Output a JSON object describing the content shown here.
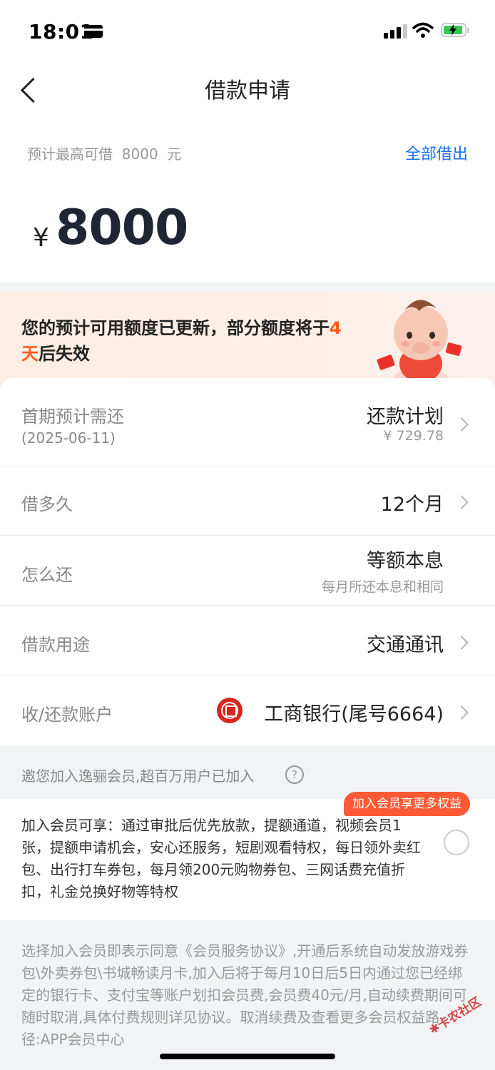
{
  "status_bar": {
    "time": "18:01"
  },
  "nav": {
    "title": "借款申请"
  },
  "amount": {
    "max_text": "预计最高可借  8000  元",
    "borrow_all": "全部借出",
    "currency": "¥",
    "value": "8000"
  },
  "banner": {
    "text_before": "您的预计可用额度已更新，部分额度将于",
    "highlight": "4天",
    "text_after": "后失效"
  },
  "rows": {
    "first_payment": {
      "label": "首期预计需还",
      "date": "(2025-06-11)",
      "value": "还款计划",
      "sub": "¥ 729.78"
    },
    "duration": {
      "label": "借多久",
      "value": "12个月"
    },
    "repay_method": {
      "label": "怎么还",
      "value": "等额本息",
      "sub": "每月所还本息和相同"
    },
    "purpose": {
      "label": "借款用途",
      "value": "交通通讯"
    },
    "account": {
      "label": "收/还款账户",
      "value": "工商银行(尾号6664)"
    }
  },
  "member": {
    "title": "邀您加入逸骊会员,超百万用户已加入",
    "badge": "加入会员享更多权益",
    "benefits": "加入会员可享：通过审批后优先放款，提额通道，视频会员1张，提额申请机会，安心还服务，短剧观看特权，每日领外卖红包、出行打车券包，每月领200元购物券包、三网话费充值折扣，礼金兑换好物等特权",
    "agreement": "选择加入会员即表示同意《会员服务协议》,开通后系统自动发放游戏券包\\外卖券包\\书城畅读月卡,加入后将于每月10日后5日内通过您已经绑定的银行卡、支付宝等账户划扣会员费,会员费40元/月,自动续费期间可随时取消,具体付费规则详见协议。取消续费及查看更多会员权益路径:APP会员中心"
  },
  "watermark": "卡农社区",
  "colors": {
    "accent_blue": "#1b6ef3",
    "highlight_orange": "#ff5a1f",
    "badge": "#ff5a35"
  }
}
